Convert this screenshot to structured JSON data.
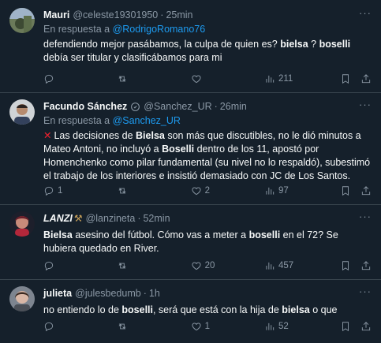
{
  "tweets": [
    {
      "name": "Mauri",
      "handle": "@celeste19301950",
      "time": "25min",
      "reply_prefix": "En respuesta a",
      "reply_to": "@RodrigoRomano76",
      "text_parts": [
        "defendiendo mejor pasábamos, la culpa de quien es? ",
        "bielsa",
        " ? ",
        "boselli",
        " debía ser titular y clasificábamos para mi"
      ],
      "replies": "",
      "retweets": "",
      "likes": "",
      "views": "211"
    },
    {
      "name": "Facundo Sánchez",
      "handle": "@Sanchez_UR",
      "time": "26min",
      "reply_prefix": "En respuesta a",
      "reply_to": "@Sanchez_UR",
      "text_parts": [
        "Las decisiones de ",
        "Bielsa",
        " son más que discutibles, no le dió minutos a Mateo Antoni, no incluyó a ",
        "Boselli",
        " dentro de los 11, apostó por Homenchenko como pilar fundamental (su nivel no lo respaldó), subestimó el trabajo de los interiores e insistió demasiado con JC de Los Santos."
      ],
      "replies": "1",
      "retweets": "",
      "likes": "2",
      "views": "97"
    },
    {
      "name": "LANZI",
      "handle": "@lanzineta",
      "time": "52min",
      "text_parts": [
        "Bielsa",
        " asesino del fútbol. Cómo vas a meter a ",
        "boselli",
        " en el 72? Se hubiera quedado en River."
      ],
      "replies": "",
      "retweets": "",
      "likes": "20",
      "views": "457"
    },
    {
      "name": "julieta",
      "handle": "@julesbedumb",
      "time": "1h",
      "text_parts": [
        "no entiendo lo de ",
        "boselli",
        ", será que está con la hija de ",
        "bielsa",
        " o que"
      ],
      "replies": "",
      "retweets": "",
      "likes": "1",
      "views": "52"
    }
  ],
  "icons": [
    "more-icon",
    "reply-icon",
    "retweet-icon",
    "like-icon",
    "views-icon",
    "bookmark-icon",
    "share-icon",
    "verified-icon"
  ],
  "colors": {
    "background": "#15202b",
    "accent": "#1d9bf0",
    "muted": "#8b98a5",
    "divider": "#38444d"
  }
}
